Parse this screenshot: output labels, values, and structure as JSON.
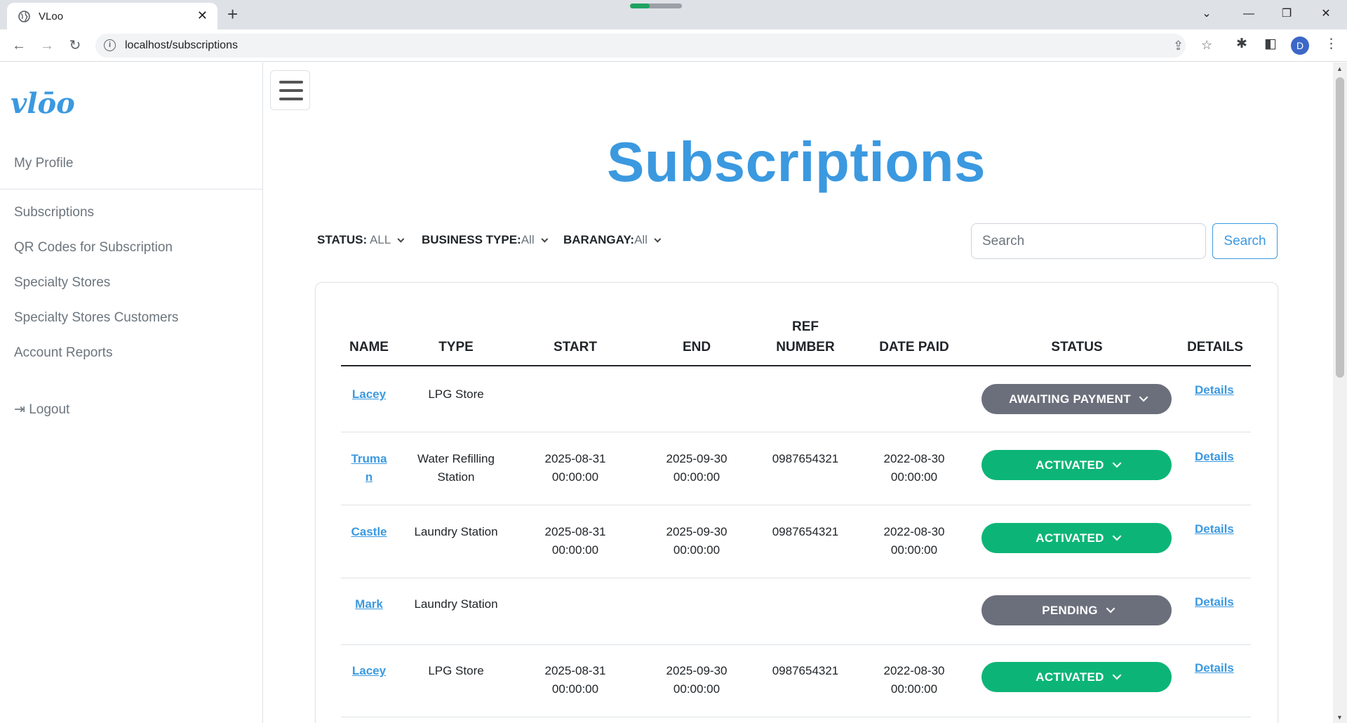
{
  "browser": {
    "tab_title": "VLoo",
    "url": "localhost/subscriptions",
    "profile_initial": "D"
  },
  "sidebar": {
    "logo_text": "vlōo",
    "profile": "My Profile",
    "items": [
      {
        "label": "Subscriptions"
      },
      {
        "label": "QR Codes for Subscription"
      },
      {
        "label": "Specialty Stores"
      },
      {
        "label": "Specialty Stores Customers"
      },
      {
        "label": "Account Reports"
      }
    ],
    "logout": "Logout"
  },
  "page": {
    "title": "Subscriptions"
  },
  "filters": {
    "status_label": "STATUS:",
    "status_value": "ALL",
    "business_label": "BUSINESS TYPE:",
    "business_value": "All",
    "barangay_label": "BARANGAY:",
    "barangay_value": "All"
  },
  "search": {
    "placeholder": "Search",
    "button": "Search"
  },
  "table": {
    "headers": {
      "name": "NAME",
      "type": "TYPE",
      "start": "START",
      "end": "END",
      "ref_1": "REF",
      "ref_2": "NUMBER",
      "date_paid": "DATE PAID",
      "status": "STATUS",
      "details": "DETAILS"
    },
    "rows": [
      {
        "name_1": "Lacey",
        "name_2": "",
        "type_1": "LPG Store",
        "type_2": "",
        "start_1": "",
        "start_2": "",
        "end_1": "",
        "end_2": "",
        "ref": "",
        "paid_1": "",
        "paid_2": "",
        "status": "AWAITING PAYMENT",
        "details": "Details"
      },
      {
        "name_1": "Truma",
        "name_2": "n",
        "type_1": "Water Refilling",
        "type_2": "Station",
        "start_1": "2025-08-31",
        "start_2": "00:00:00",
        "end_1": "2025-09-30",
        "end_2": "00:00:00",
        "ref": "0987654321",
        "paid_1": "2022-08-30",
        "paid_2": "00:00:00",
        "status": "ACTIVATED",
        "details": "Details"
      },
      {
        "name_1": "Castle",
        "name_2": "",
        "type_1": "Laundry Station",
        "type_2": "",
        "start_1": "2025-08-31",
        "start_2": "00:00:00",
        "end_1": "2025-09-30",
        "end_2": "00:00:00",
        "ref": "0987654321",
        "paid_1": "2022-08-30",
        "paid_2": "00:00:00",
        "status": "ACTIVATED",
        "details": "Details"
      },
      {
        "name_1": "Mark",
        "name_2": "",
        "type_1": "Laundry Station",
        "type_2": "",
        "start_1": "",
        "start_2": "",
        "end_1": "",
        "end_2": "",
        "ref": "",
        "paid_1": "",
        "paid_2": "",
        "status": "PENDING",
        "details": "Details"
      },
      {
        "name_1": "Lacey",
        "name_2": "",
        "type_1": "LPG Store",
        "type_2": "",
        "start_1": "2025-08-31",
        "start_2": "00:00:00",
        "end_1": "2025-09-30",
        "end_2": "00:00:00",
        "ref": "0987654321",
        "paid_1": "2022-08-30",
        "paid_2": "00:00:00",
        "status": "ACTIVATED",
        "details": "Details"
      }
    ]
  },
  "colors": {
    "accent": "#3b99e0",
    "activated": "#0cb577",
    "pending": "#6b6f7b"
  }
}
